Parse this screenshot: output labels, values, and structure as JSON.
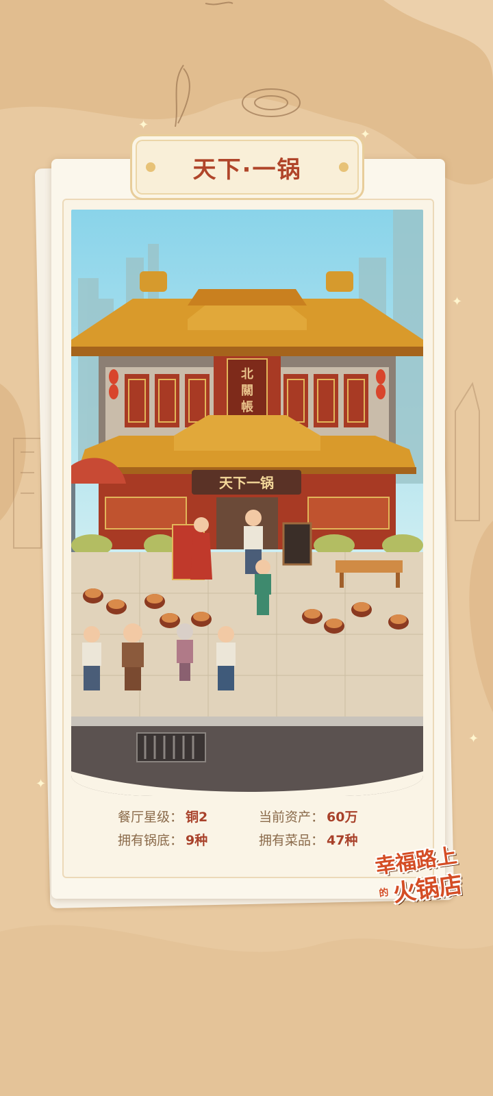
{
  "title": "天下·一锅",
  "shop_sign": "天下一锅",
  "upper_sign": "北關帳",
  "stats": [
    {
      "label": "餐厅星级：",
      "value": "铜2"
    },
    {
      "label": "当前资产：",
      "value": "60万"
    },
    {
      "label": "拥有锅底：",
      "value": "9种"
    },
    {
      "label": "拥有菜品：",
      "value": "47种"
    }
  ],
  "logo": {
    "line1": "幸福路上",
    "line_small": "的",
    "line2": "火锅店"
  },
  "colors": {
    "accent": "#b0452a",
    "background": "#e8c9a0",
    "roof": "#d99a2b",
    "wall": "#a83a24"
  }
}
